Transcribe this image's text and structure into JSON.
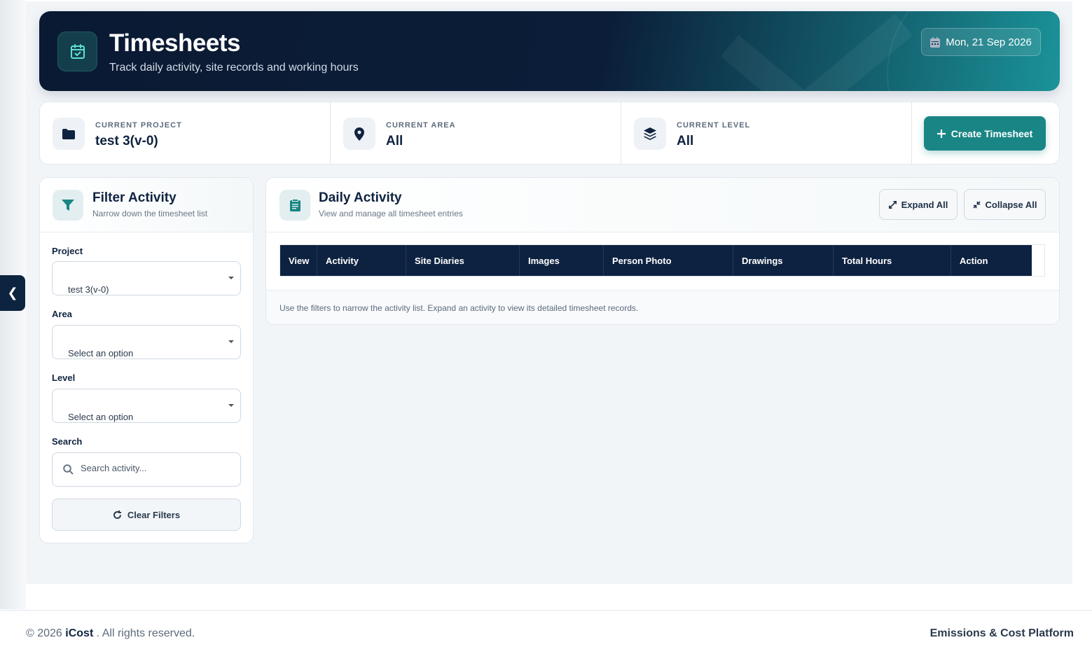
{
  "header": {
    "title": "Timesheets",
    "subtitle": "Track daily activity, site records and working hours",
    "date": "Mon, 21 Sep 2026"
  },
  "info": {
    "project_label": "CURRENT PROJECT",
    "project_value": "test 3(v-0)",
    "area_label": "CURRENT AREA",
    "area_value": "All",
    "level_label": "CURRENT LEVEL",
    "level_value": "All",
    "create_label": "Create Timesheet"
  },
  "filter": {
    "title": "Filter Activity",
    "subtitle": "Narrow down the timesheet list",
    "project_label": "Project",
    "project_value": "test 3(v-0)",
    "area_label": "Area",
    "area_value": "Select an option",
    "level_label": "Level",
    "level_value": "Select an option",
    "search_label": "Search",
    "search_placeholder": "Search activity...",
    "clear_label": "Clear Filters"
  },
  "activity": {
    "title": "Daily Activity",
    "subtitle": "View and manage all timesheet entries",
    "expand_label": "Expand All",
    "collapse_label": "Collapse All",
    "columns": [
      "View",
      "Activity",
      "Site Diaries",
      "Images",
      "Person Photo",
      "Drawings",
      "Total Hours",
      "Action"
    ],
    "hint": "Use the filters to narrow the activity list. Expand an activity to view its detailed timesheet records."
  },
  "footer": {
    "copyright_prefix": "© 2026",
    "brand": "iCost",
    "copyright_suffix": ". All rights reserved.",
    "platform": "Emissions & Cost Platform"
  },
  "sidebar": {
    "toggle_glyph": "❮"
  },
  "colors": {
    "navy": "#0d2240",
    "teal": "#1a8585",
    "accent_icon": "#5fe0d2"
  },
  "icons": {
    "banner": "calendar-check-icon",
    "date": "calendar-icon",
    "project": "folder-icon",
    "area": "map-pin-icon",
    "level": "layers-icon",
    "create": "plus-icon",
    "filter": "funnel-icon",
    "search": "search-icon",
    "clear": "refresh-icon",
    "activity": "clipboard-list-icon",
    "expand": "expand-icon",
    "collapse": "collapse-icon"
  }
}
